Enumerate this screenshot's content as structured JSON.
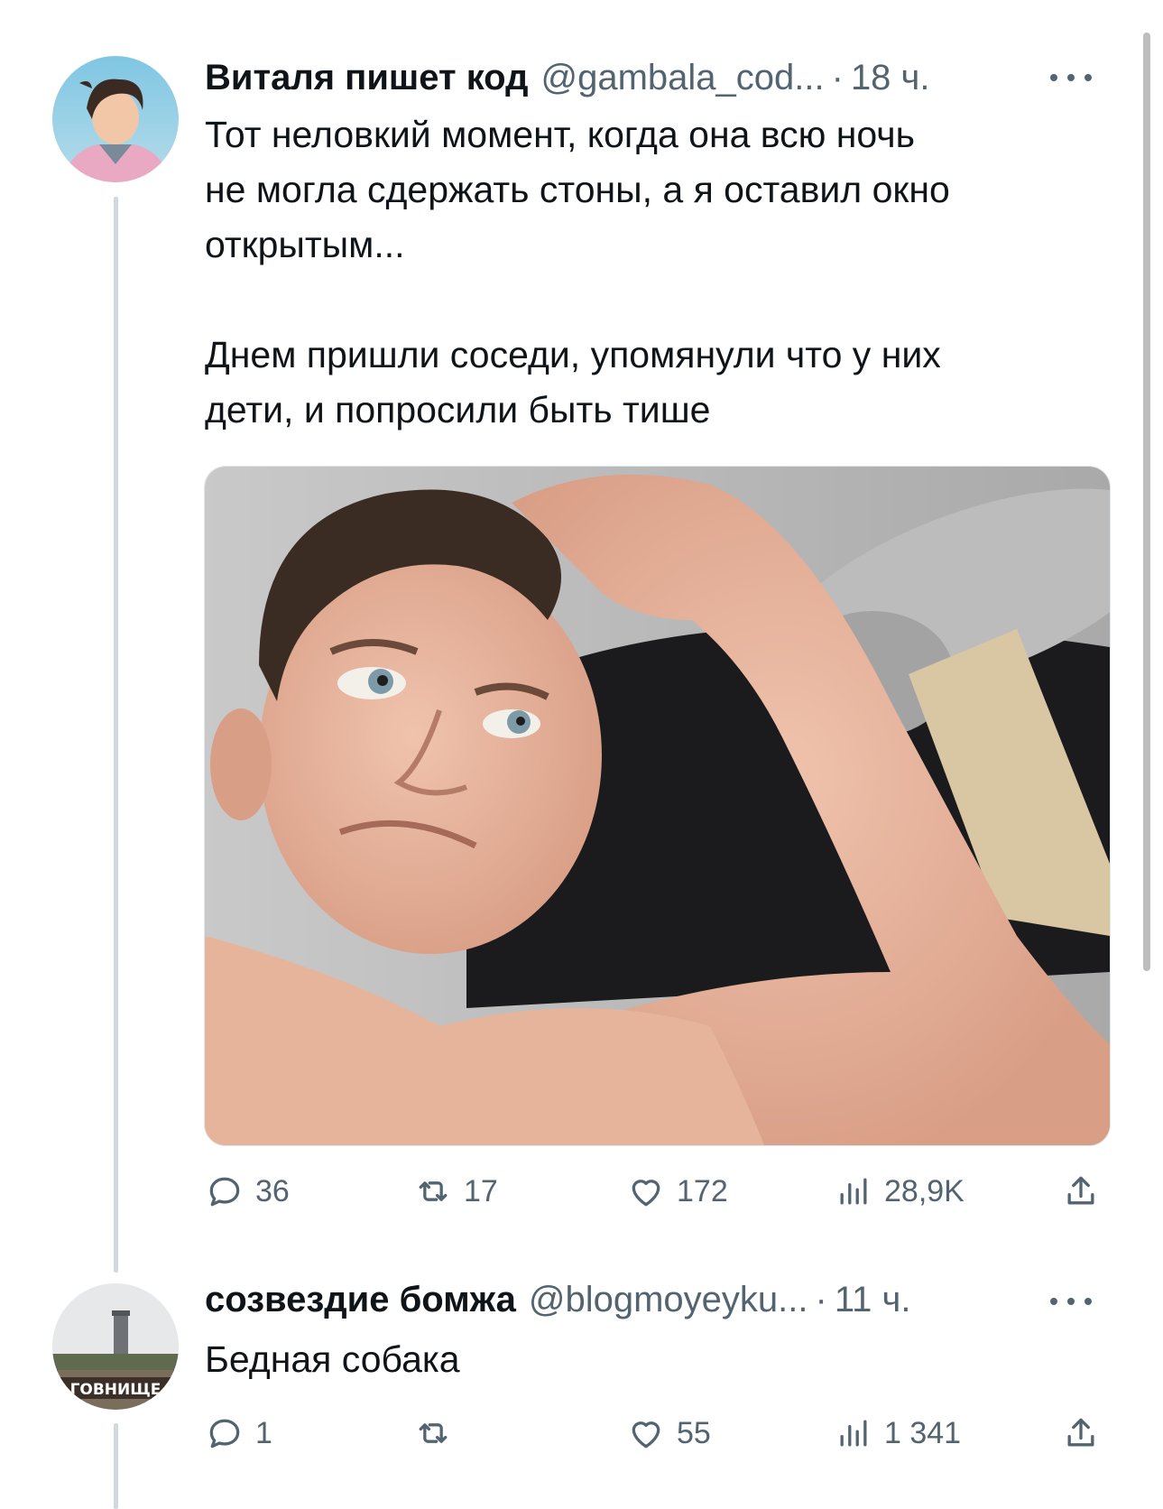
{
  "tweets": [
    {
      "author_name": "Виталя пишет код",
      "handle": "@gambala_cod...",
      "separator": "·",
      "time": "18 ч.",
      "more_icon": "more-horizontal-icon",
      "text_paragraphs": [
        "Тот неловкий момент, когда она всю ночь\nне могла сдержать стоны, а я оставил окно\nоткрытым...",
        "Днем пришли соседи, упомянули что у них\nдети, и попросили быть тише"
      ],
      "media": "photo",
      "actions": {
        "replies": "36",
        "retweets": "17",
        "likes": "172",
        "views": "28,9K"
      }
    },
    {
      "author_name": "созвездие бомжа",
      "handle": "@blogmoyeyku...",
      "separator": "·",
      "time": "11 ч.",
      "more_icon": "more-horizontal-icon",
      "text": "Бедная собака",
      "avatar_sign_text": "ГОВНИЩЕ",
      "actions": {
        "replies": "1",
        "retweets": "",
        "likes": "55",
        "views": "1 341"
      }
    }
  ],
  "colors": {
    "text_primary": "#0f1419",
    "text_secondary": "#536471",
    "thread_line": "#cfd9de",
    "background": "#ffffff"
  },
  "icons": [
    "reply-icon",
    "retweet-icon",
    "like-icon",
    "views-icon",
    "share-icon"
  ]
}
